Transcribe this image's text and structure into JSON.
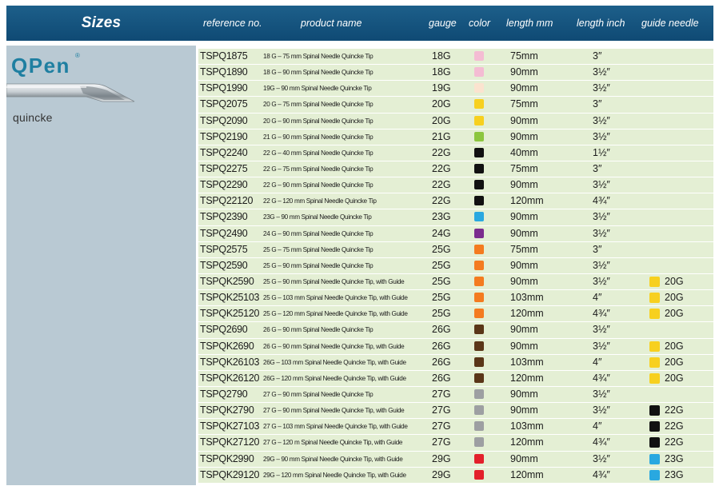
{
  "header": {
    "title": "Sizes",
    "columns": {
      "reference": "reference no.",
      "product": "product name",
      "gauge": "gauge",
      "color": "color",
      "length_mm": "length mm",
      "length_inch": "length inch",
      "guide": "guide needle"
    }
  },
  "brand": {
    "name": "QPen",
    "reg": "®",
    "tip": "quincke"
  },
  "colors": {
    "header": "#0f4a74",
    "panel": "#b9c9d3",
    "row": "#e4efd4",
    "brand": "#1f7fa1"
  },
  "rows": [
    {
      "ref": "TSPQ1875",
      "name": "18 G – 75 mm Spinal Needle Quincke Tip",
      "gauge": "18G",
      "color": "#f4bcd3",
      "mm": "75mm",
      "inch": "3″",
      "guide": null,
      "guide_color": null
    },
    {
      "ref": "TSPQ1890",
      "name": "18 G – 90 mm Spinal Needle Quincke Tip",
      "gauge": "18G",
      "color": "#f4bcd3",
      "mm": "90mm",
      "inch": "3½″",
      "guide": null,
      "guide_color": null
    },
    {
      "ref": "TSPQ1990",
      "name": "19G – 90 mm  Spinal Needle Quincke Tip",
      "gauge": "19G",
      "color": "#fbe3cf",
      "mm": "90mm",
      "inch": "3½″",
      "guide": null,
      "guide_color": null
    },
    {
      "ref": "TSPQ2075",
      "name": "20 G – 75 mm Spinal Needle Quincke Tip",
      "gauge": "20G",
      "color": "#f7d01f",
      "mm": "75mm",
      "inch": "3″",
      "guide": null,
      "guide_color": null
    },
    {
      "ref": "TSPQ2090",
      "name": "20 G – 90 mm Spinal Needle Quincke Tip",
      "gauge": "20G",
      "color": "#f7d01f",
      "mm": "90mm",
      "inch": "3½″",
      "guide": null,
      "guide_color": null
    },
    {
      "ref": "TSPQ2190",
      "name": "21 G – 90 mm Spinal Needle Quincke Tip",
      "gauge": "21G",
      "color": "#8cc63f",
      "mm": "90mm",
      "inch": "3½″",
      "guide": null,
      "guide_color": null
    },
    {
      "ref": "TSPQ2240",
      "name": "22 G – 40 mm Spinal Needle Quincke Tip",
      "gauge": "22G",
      "color": "#111111",
      "mm": "40mm",
      "inch": "1½″",
      "guide": null,
      "guide_color": null
    },
    {
      "ref": "TSPQ2275",
      "name": "22 G – 75 mm Spinal Needle Quincke Tip",
      "gauge": "22G",
      "color": "#111111",
      "mm": "75mm",
      "inch": "3″",
      "guide": null,
      "guide_color": null
    },
    {
      "ref": "TSPQ2290",
      "name": "22 G – 90 mm Spinal Needle Quincke Tip",
      "gauge": "22G",
      "color": "#111111",
      "mm": "90mm",
      "inch": "3½″",
      "guide": null,
      "guide_color": null
    },
    {
      "ref": "TSPQ22120",
      "name": "22 G – 120 mm Spinal Needle Quincke Tip",
      "gauge": "22G",
      "color": "#111111",
      "mm": "120mm",
      "inch": "4¾″",
      "guide": null,
      "guide_color": null
    },
    {
      "ref": "TSPQ2390",
      "name": "23G – 90 mm  Spinal Needle Quincke Tip",
      "gauge": "23G",
      "color": "#29a8e0",
      "mm": "90mm",
      "inch": "3½″",
      "guide": null,
      "guide_color": null
    },
    {
      "ref": "TSPQ2490",
      "name": "24 G – 90 mm Spinal Needle Quincke Tip",
      "gauge": "24G",
      "color": "#7b2c8e",
      "mm": "90mm",
      "inch": "3½″",
      "guide": null,
      "guide_color": null
    },
    {
      "ref": "TSPQ2575",
      "name": "25 G – 75 mm Spinal Needle Quincke Tip",
      "gauge": "25G",
      "color": "#f47b20",
      "mm": "75mm",
      "inch": "3″",
      "guide": null,
      "guide_color": null
    },
    {
      "ref": "TSPQ2590",
      "name": "25 G – 90 mm Spinal Needle Quincke Tip",
      "gauge": "25G",
      "color": "#f47b20",
      "mm": "90mm",
      "inch": "3½″",
      "guide": null,
      "guide_color": null
    },
    {
      "ref": "TSPQK2590",
      "name": "25 G – 90 mm Spinal Needle Quincke Tip, with Guide",
      "gauge": "25G",
      "color": "#f47b20",
      "mm": "90mm",
      "inch": "3½″",
      "guide": "20G",
      "guide_color": "#f7d01f"
    },
    {
      "ref": "TSPQK25103",
      "name": "25 G – 103 mm Spinal Needle Quincke Tip, with Guide",
      "gauge": "25G",
      "color": "#f47b20",
      "mm": "103mm",
      "inch": "4″",
      "guide": "20G",
      "guide_color": "#f7d01f"
    },
    {
      "ref": "TSPQK25120",
      "name": "25 G – 120 mm Spinal Needle Quincke Tip, with Guide",
      "gauge": "25G",
      "color": "#f47b20",
      "mm": "120mm",
      "inch": "4¾″",
      "guide": "20G",
      "guide_color": "#f7d01f"
    },
    {
      "ref": "TSPQ2690",
      "name": "26 G – 90 mm Spinal Needle Quincke Tip",
      "gauge": "26G",
      "color": "#5a3618",
      "mm": "90mm",
      "inch": "3½″",
      "guide": null,
      "guide_color": null
    },
    {
      "ref": "TSPQK2690",
      "name": "26 G – 90 mm Spinal Needle Quincke Tip, with Guide",
      "gauge": "26G",
      "color": "#5a3618",
      "mm": "90mm",
      "inch": "3½″",
      "guide": "20G",
      "guide_color": "#f7d01f"
    },
    {
      "ref": "TSPQK26103",
      "name": "26G – 103 mm  Spinal Needle Quincke Tip, with Guide",
      "gauge": "26G",
      "color": "#5a3618",
      "mm": "103mm",
      "inch": "4″",
      "guide": "20G",
      "guide_color": "#f7d01f"
    },
    {
      "ref": "TSPQK26120",
      "name": "26G – 120 mm  Spinal Needle Quincke Tip, with Guide",
      "gauge": "26G",
      "color": "#5a3618",
      "mm": "120mm",
      "inch": "4¾″",
      "guide": "20G",
      "guide_color": "#f7d01f"
    },
    {
      "ref": "TSPQ2790",
      "name": "27 G – 90 mm Spinal Needle Quincke Tip",
      "gauge": "27G",
      "color": "#9d9fa2",
      "mm": "90mm",
      "inch": "3½″",
      "guide": null,
      "guide_color": null
    },
    {
      "ref": "TSPQK2790",
      "name": "27 G – 90 mm  Spinal Needle Quincke Tip, with Guide",
      "gauge": "27G",
      "color": "#9d9fa2",
      "mm": "90mm",
      "inch": "3½″",
      "guide": "22G",
      "guide_color": "#111111"
    },
    {
      "ref": "TSPQK27103",
      "name": "27 G – 103 mm  Spinal Needle Quincke Tip, with Guide",
      "gauge": "27G",
      "color": "#9d9fa2",
      "mm": "103mm",
      "inch": "4″",
      "guide": "22G",
      "guide_color": "#111111"
    },
    {
      "ref": "TSPQK27120",
      "name": "27 G – 120 m Spinal Needle Quincke Tip, with Guide",
      "gauge": "27G",
      "color": "#9d9fa2",
      "mm": "120mm",
      "inch": "4¾″",
      "guide": "22G",
      "guide_color": "#111111"
    },
    {
      "ref": "TSPQK2990",
      "name": "29G – 90 mm  Spinal Needle Quincke Tip, with Guide",
      "gauge": "29G",
      "color": "#e3202b",
      "mm": "90mm",
      "inch": "3½″",
      "guide": "23G",
      "guide_color": "#29a8e0"
    },
    {
      "ref": "TSPQK29120",
      "name": "29G – 120 mm  Spinal Needle Quincke Tip, with Guide",
      "gauge": "29G",
      "color": "#e3202b",
      "mm": "120mm",
      "inch": "4¾″",
      "guide": "23G",
      "guide_color": "#29a8e0"
    }
  ]
}
